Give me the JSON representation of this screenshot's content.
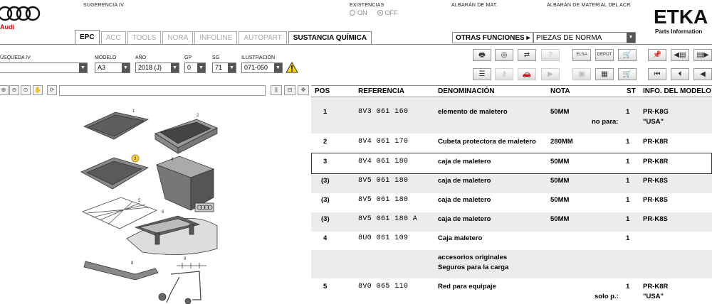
{
  "header": {
    "brand": "Audi",
    "sugerencia": "SUGERENCIA IV",
    "existencias_label": "EXISTENCIAS",
    "existencias_on": "ON",
    "existencias_off": "OFF",
    "albaran_mat": "ALBARÁN DE MAT.",
    "albaran_acr": "ALBARÁN DE MATERIAL DEL ACR",
    "etka_title": "ETKA",
    "etka_sub": "Parts Information"
  },
  "tabs": [
    {
      "label": "EPC",
      "state": "active"
    },
    {
      "label": "ACC",
      "state": "disabled"
    },
    {
      "label": "TOOLS",
      "state": "disabled"
    },
    {
      "label": "NORA",
      "state": "disabled"
    },
    {
      "label": "INFOLINE",
      "state": "disabled"
    },
    {
      "label": "AUTOPART",
      "state": "disabled"
    },
    {
      "label": "SUSTANCIA QUÍMICA",
      "state": "enabled"
    }
  ],
  "funciones": {
    "label": "OTRAS FUNCIONES ▸",
    "select_value": "PIEZAS DE NORMA"
  },
  "filters": {
    "busqueda_label": "ÚSQUEDA IV",
    "modelo_label": "MODELO",
    "modelo_value": "A3",
    "ano_label": "AÑO",
    "ano_value": "2018 (J)",
    "gp_label": "GP",
    "gp_value": "0",
    "sg_label": "SG",
    "sg_value": "71",
    "ilustracion_label": "ILUSTRACIÓN",
    "ilustracion_value": "071-050"
  },
  "toolbar_icons": {
    "row1": [
      "print-icon",
      "disc-icon",
      "transfer-icon",
      "help-icon",
      "elsa-icon",
      "depot-icon",
      "cart-icon"
    ],
    "row1_text": {
      "elsa": "ELSA",
      "depot": "DEPOT"
    },
    "row2": [
      "list-icon",
      "key-icon",
      "car-icon",
      "next-icon",
      "image-cart-icon",
      "multi-cart-icon",
      "cart-list-icon"
    ],
    "nav_row1": [
      "pin-icon",
      "prev-page-icon",
      "next-page-icon"
    ],
    "nav_row2": [
      "first-icon",
      "prev-icon",
      "back-icon"
    ]
  },
  "table": {
    "headers": {
      "pos": "POS",
      "referencia": "REFERENCIA",
      "denominacion": "DENOMINACIÓN",
      "nota": "NOTA",
      "st": "ST",
      "info": "INFO. DEL MODELO"
    },
    "rows": [
      {
        "pos": "1",
        "ref": "8V3 061 160",
        "denom": "elemento de maletero",
        "nota": "50MM",
        "st": "1",
        "info": "PR-K8G",
        "sub_label": "no para:",
        "sub_info": "\"USA\""
      },
      {
        "pos": "2",
        "ref": "8V4 061 170",
        "denom": "Cubeta protectora de maletero",
        "nota": "280MM",
        "st": "1",
        "info": "PR-K8R"
      },
      {
        "pos": "3",
        "ref": "8V4 061 180",
        "denom": "caja de maletero",
        "nota": "50MM",
        "st": "1",
        "info": "PR-K8R"
      },
      {
        "pos": "(3)",
        "ref": "8V5 061 180",
        "denom": "caja de maletero",
        "nota": "50MM",
        "st": "1",
        "info": "PR-K8S"
      },
      {
        "pos": "(3)",
        "ref": "8V5 061 180",
        "denom": "caja de maletero",
        "nota": "50MM",
        "st": "1",
        "info": "PR-K8S"
      },
      {
        "pos": "(3)",
        "ref": "8V5 061 180 A",
        "denom": "caja de maletero",
        "nota": "50MM",
        "st": "1",
        "info": "PR-K8S"
      },
      {
        "pos": "4",
        "ref": "8U0 061 109",
        "denom": "Caja maletero",
        "nota": "",
        "st": "1",
        "info": ""
      },
      {
        "pos": "",
        "ref": "",
        "denom": "accesorios originales",
        "denom2": "Seguros para la carga",
        "nota": "",
        "st": "",
        "info": ""
      },
      {
        "pos": "5",
        "ref": "8V0 065 110",
        "denom": "Red para equipaje",
        "nota": "",
        "st": "1",
        "info": "PR-K8R",
        "sub_label": "solo p.:",
        "sub_info": "\"USA\""
      }
    ]
  },
  "illustration": {
    "callouts": [
      "1",
      "2",
      "3",
      "4",
      "5",
      "6",
      "7",
      "8",
      "9"
    ]
  }
}
